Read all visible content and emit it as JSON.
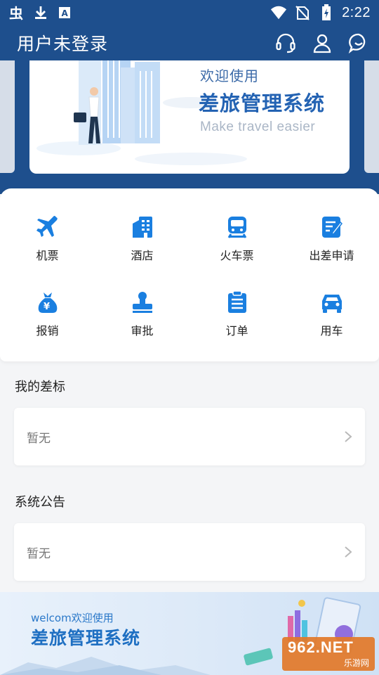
{
  "status_bar": {
    "time": "2:22",
    "icons": [
      "app-notification-icon",
      "download-icon",
      "a-box-icon",
      "wifi-icon",
      "no-sim-icon",
      "battery-charging-icon"
    ]
  },
  "header": {
    "title": "用户未登录",
    "actions": [
      "headset-icon",
      "user-icon",
      "chat-icon"
    ]
  },
  "banner": {
    "welcome": "欢迎使用",
    "system": "差旅管理系统",
    "slogan": "Make travel easier"
  },
  "services": [
    {
      "label": "机票",
      "icon": "airplane-icon"
    },
    {
      "label": "酒店",
      "icon": "hotel-icon"
    },
    {
      "label": "火车票",
      "icon": "train-icon"
    },
    {
      "label": "出差申请",
      "icon": "edit-document-icon"
    },
    {
      "label": "报销",
      "icon": "money-bag-icon"
    },
    {
      "label": "审批",
      "icon": "stamp-icon"
    },
    {
      "label": "订单",
      "icon": "clipboard-icon"
    },
    {
      "label": "用车",
      "icon": "car-icon"
    }
  ],
  "travel_standard": {
    "title": "我的差标",
    "content": "暂无"
  },
  "announcement": {
    "title": "系统公告",
    "content": "暂无"
  },
  "bottom_banner": {
    "welcome": "welcom欢迎使用",
    "system": "差旅管理系统"
  },
  "watermark": {
    "main": "962.NET",
    "sub": "乐游网"
  },
  "colors": {
    "header_bg": "#1e4f8d",
    "icon_blue": "#1a7fe0",
    "banner_text": "#2463b3"
  }
}
